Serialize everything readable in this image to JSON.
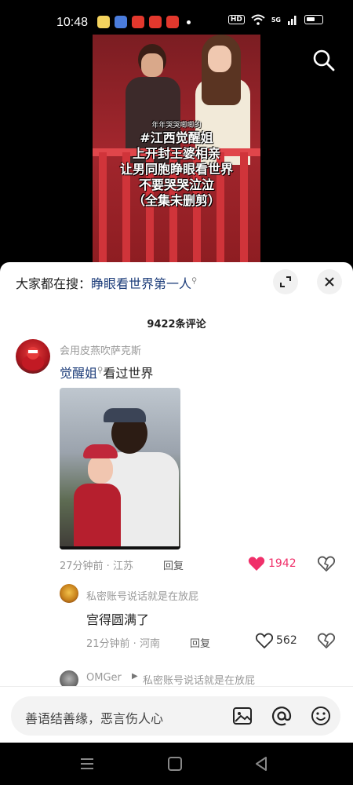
{
  "status_bar": {
    "time": "10:48",
    "hd": "HD",
    "network": "5G",
    "app_icon_colors": [
      "#f4d35e",
      "#4a7cdc",
      "#e2382d",
      "#e2382d",
      "#e2382d"
    ]
  },
  "video": {
    "caption_small": "年年哭哭唧唧的",
    "caption_lines": [
      "#江西觉醒姐",
      "上开封王婆相亲",
      "让男同胞睁眼看世界",
      "不要哭哭泣泣",
      "（全集未删剪）"
    ]
  },
  "comments_sheet": {
    "search_prefix": "大家都在搜：",
    "search_keyword": "睁眼看世界第一人",
    "count_label": "9422条评论",
    "comments": [
      {
        "user": "会用皮燕吹萨克斯",
        "text_link": "觉醒姐",
        "text_rest": "看过世界",
        "time_location": "27分钟前 · 江苏",
        "reply_label": "回复",
        "likes": "1942",
        "liked": true
      },
      {
        "user": "私密账号说话就是在放屁",
        "text": "宫得圆满了",
        "time_location": "21分钟前 · 河南",
        "reply_label": "回复",
        "likes": "562",
        "liked": false
      },
      {
        "user": "OMGer",
        "reply_to": "私密账号说话就是在放屁"
      }
    ],
    "input_placeholder": "善语结善缘，恶言伤人心"
  },
  "colors": {
    "accent_link": "#1d3d7a",
    "like_red": "#f0306a"
  }
}
